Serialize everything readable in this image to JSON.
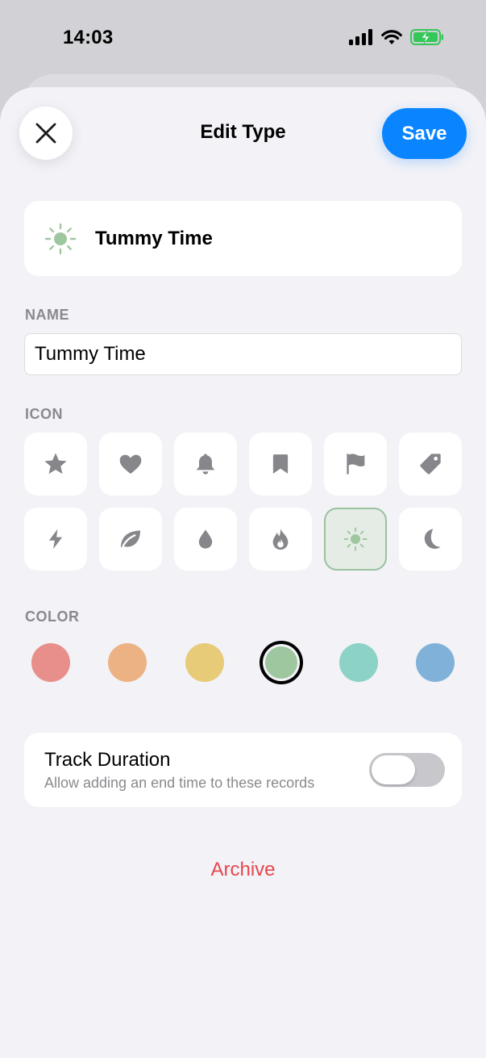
{
  "status_bar": {
    "time": "14:03",
    "icons": [
      "cellular-signal-icon",
      "wifi-icon",
      "battery-charging-icon"
    ],
    "battery_color": "#34c759"
  },
  "header": {
    "close_icon": "close-icon",
    "title": "Edit Type",
    "save_label": "Save",
    "accent_color": "#0a84ff"
  },
  "preview": {
    "icon": "sun-icon",
    "name": "Tummy Time"
  },
  "name_section": {
    "label": "NAME",
    "value": "Tummy Time"
  },
  "icon_section": {
    "label": "ICON",
    "selected": "sun",
    "icons": [
      "star",
      "heart",
      "bell",
      "bookmark",
      "flag",
      "tag",
      "bolt",
      "leaf",
      "drop",
      "flame",
      "sun",
      "moon"
    ]
  },
  "color_section": {
    "label": "COLOR",
    "selected_index": 3,
    "colors": [
      "#e88f8c",
      "#edb283",
      "#e8cb78",
      "#9fc79f",
      "#8dd2c6",
      "#80b2d9"
    ]
  },
  "track_duration": {
    "title": "Track Duration",
    "subtitle": "Allow adding an end time to these records",
    "enabled": false
  },
  "archive_label": "Archive",
  "archive_color": "#e5484d"
}
